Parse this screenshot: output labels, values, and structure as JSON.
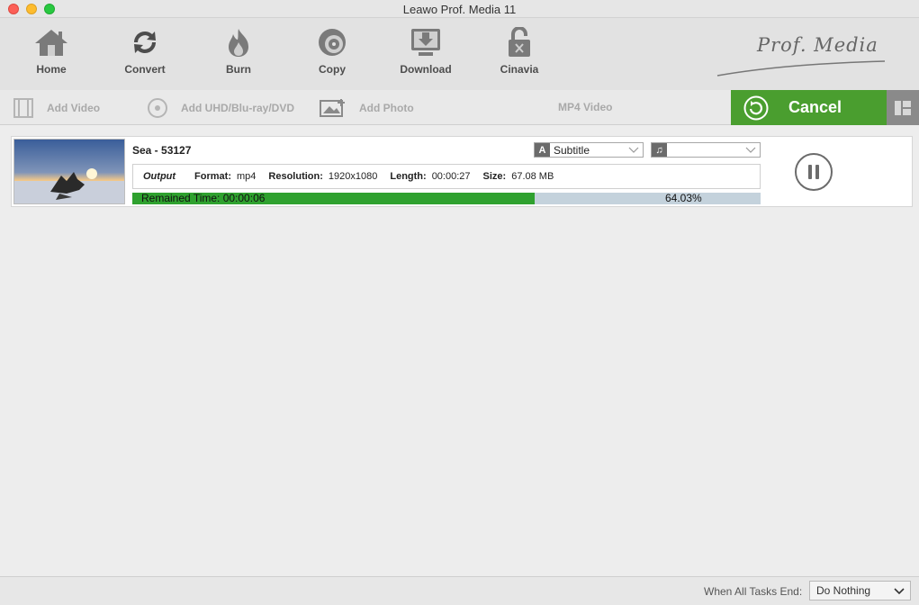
{
  "window": {
    "title": "Leawo Prof. Media 11"
  },
  "toolbar": {
    "items": [
      {
        "label": "Home",
        "icon": "home-icon"
      },
      {
        "label": "Convert",
        "icon": "convert-icon"
      },
      {
        "label": "Burn",
        "icon": "flame-icon"
      },
      {
        "label": "Copy",
        "icon": "disc-copy-icon"
      },
      {
        "label": "Download",
        "icon": "download-icon"
      },
      {
        "label": "Cinavia",
        "icon": "unlock-icon"
      }
    ],
    "logo_text": "Prof. Media"
  },
  "subbar": {
    "add_video": "Add Video",
    "add_disc": "Add UHD/Blu-ray/DVD",
    "add_photo": "Add Photo",
    "format": "MP4 Video",
    "cancel_label": "Cancel"
  },
  "task": {
    "name": "Sea - 53127",
    "subtitle_label": "Subtitle",
    "audio_value": "",
    "output_label": "Output",
    "format_key": "Format:",
    "format_val": "mp4",
    "resolution_key": "Resolution:",
    "resolution_val": "1920x1080",
    "length_key": "Length:",
    "length_val": "00:00:27",
    "size_key": "Size:",
    "size_val": "67.08 MB",
    "remained_time": "Remained Time: 00:00:06",
    "progress_text": "64.03%",
    "progress_value": 64.03
  },
  "statusbar": {
    "when_label": "When All Tasks End:",
    "action_value": "Do Nothing"
  },
  "colors": {
    "accent_green": "#4a9e2f",
    "progress_green": "#2fa12f",
    "progress_track": "#c4d2dc"
  }
}
